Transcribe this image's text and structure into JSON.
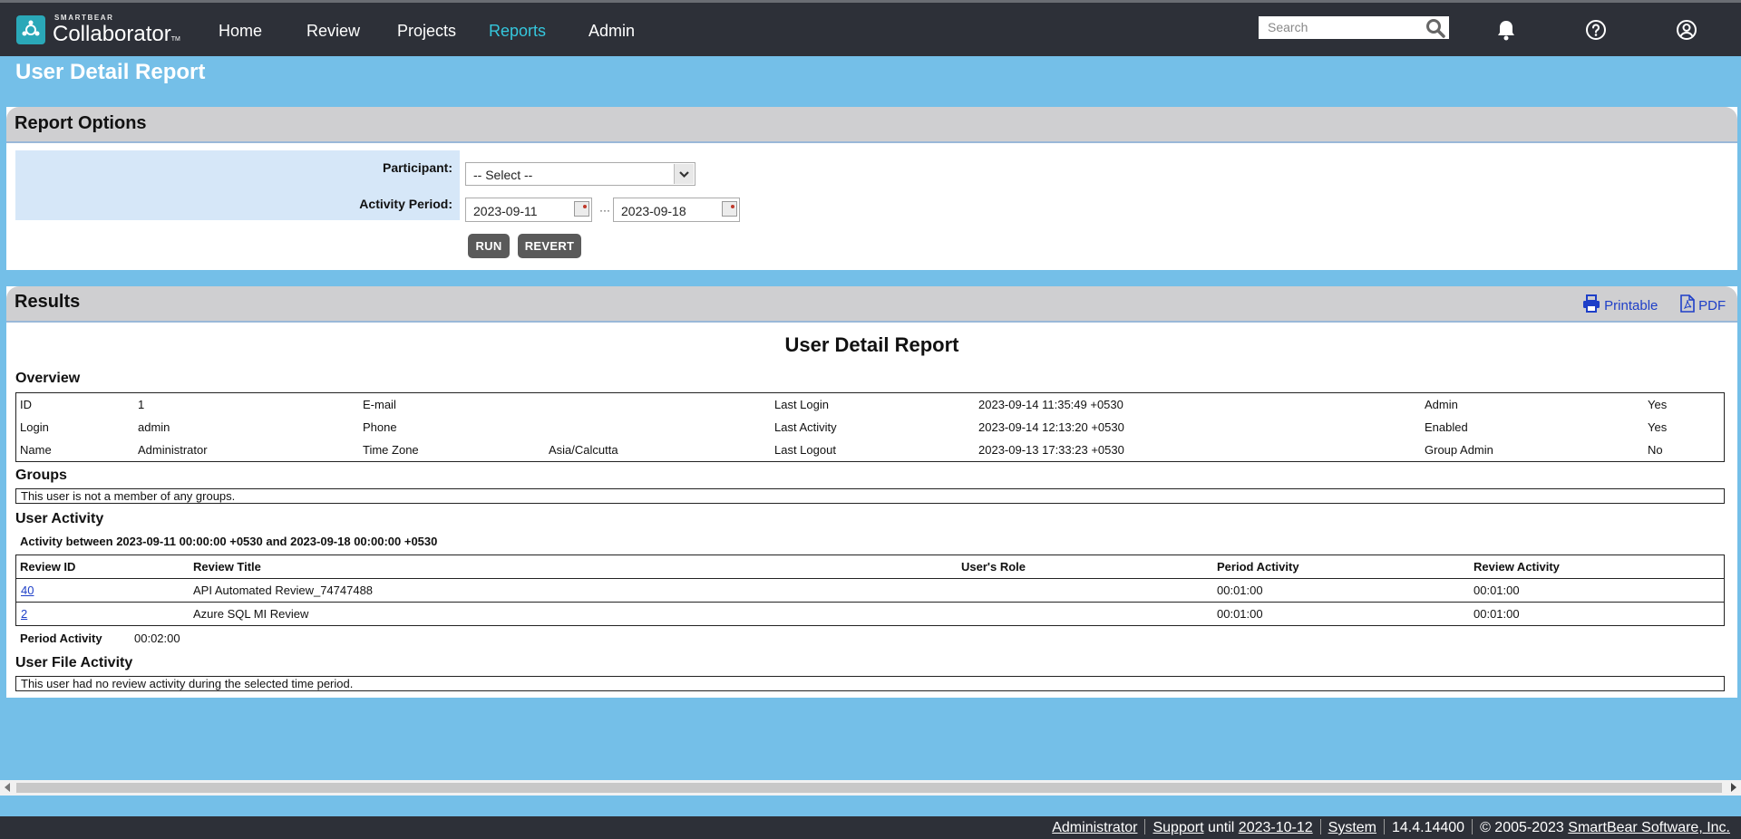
{
  "app": {
    "brand_small": "SMARTBEAR",
    "brand_name": "Collaborator",
    "brand_tm": "TM",
    "nav": [
      {
        "label": "Home"
      },
      {
        "label": "Review"
      },
      {
        "label": "Projects"
      },
      {
        "label": "Reports",
        "active": true
      },
      {
        "label": "Admin"
      }
    ],
    "search_placeholder": "Search",
    "icons": [
      "search-icon",
      "bell-icon",
      "help-icon",
      "user-icon"
    ],
    "accent_color": "#35c7dd",
    "link_color": "#1e3fc8",
    "background_color": "#74bfe8"
  },
  "page": {
    "title": "User Detail Report"
  },
  "options": {
    "title": "Report Options",
    "participant_label": "Participant:",
    "participant_value": "-- Select --",
    "period_label": "Activity Period:",
    "date_from": "2023-09-11",
    "date_sep": "···",
    "date_to": "2023-09-18",
    "run_label": "RUN",
    "revert_label": "REVERT"
  },
  "results": {
    "title": "Results",
    "printable_label": "Printable",
    "pdf_label": "PDF",
    "report_title": "User Detail Report",
    "overview": {
      "heading": "Overview",
      "rows": [
        [
          "ID",
          "1",
          "E-mail",
          "",
          "Last Login",
          "2023-09-14 11:35:49 +0530",
          "Admin",
          "Yes"
        ],
        [
          "Login",
          "admin",
          "Phone",
          "",
          "Last Activity",
          "2023-09-14 12:13:20 +0530",
          "Enabled",
          "Yes"
        ],
        [
          "Name",
          "Administrator",
          "Time Zone",
          "Asia/Calcutta",
          "Last Logout",
          "2023-09-13 17:33:23 +0530",
          "Group Admin",
          "No"
        ]
      ]
    },
    "groups": {
      "heading": "Groups",
      "note": "This user is not a member of any groups."
    },
    "activity": {
      "heading": "User Activity",
      "caption": "Activity between 2023-09-11 00:00:00 +0530 and 2023-09-18 00:00:00 +0530",
      "columns": [
        "Review ID",
        "Review Title",
        "User's Role",
        "Period Activity",
        "Review Activity"
      ],
      "rows": [
        [
          "40",
          "API Automated Review_74747488",
          "",
          "00:01:00",
          "00:01:00"
        ],
        [
          "2",
          "Azure SQL MI Review",
          "",
          "00:01:00",
          "00:01:00"
        ]
      ],
      "total_label": "Period Activity",
      "total_value": "00:02:00"
    },
    "file_activity": {
      "heading": "User File Activity",
      "note": "This user had no review activity during the selected time period."
    }
  },
  "footer": {
    "user": "Administrator",
    "support": "Support",
    "until": "until",
    "support_date": "2023-10-12",
    "system": "System",
    "version": "14.4.14400",
    "copyright": "© 2005-2023",
    "company": "SmartBear Software, Inc."
  }
}
